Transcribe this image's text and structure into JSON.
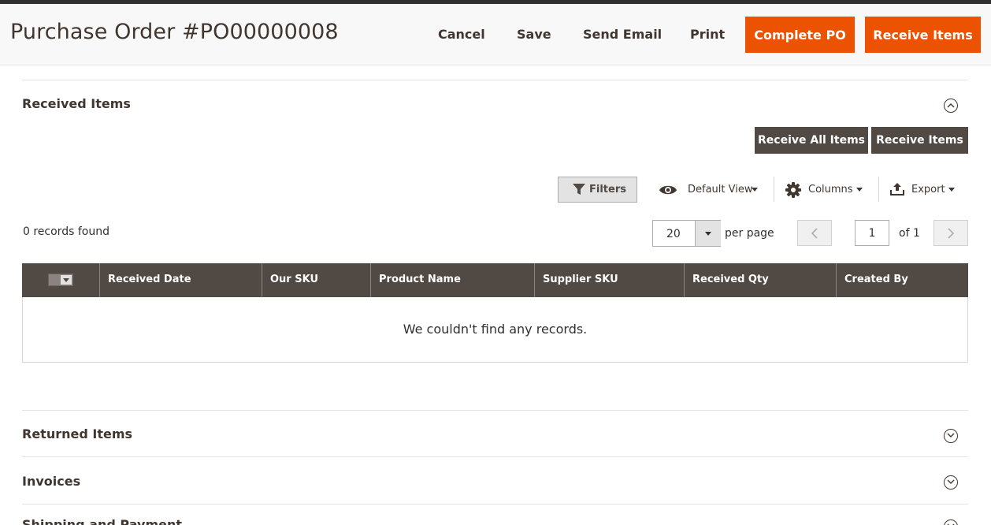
{
  "page": {
    "title": "Purchase Order #PO00000008"
  },
  "header_actions": {
    "cancel": "Cancel",
    "save": "Save",
    "send_email": "Send Email",
    "print": "Print",
    "complete_po": "Complete PO",
    "receive_items": "Receive Items"
  },
  "sections": {
    "received": {
      "title": "Received Items",
      "state": "expanded"
    },
    "returned": {
      "title": "Returned Items",
      "state": "collapsed"
    },
    "invoices": {
      "title": "Invoices",
      "state": "collapsed"
    },
    "shipping": {
      "title": "Shipping and Payment",
      "state": "collapsed"
    }
  },
  "received_actions": {
    "receive_all": "Receive All Items",
    "receive_items": "Receive Items"
  },
  "toolbar": {
    "filters": "Filters",
    "view": "Default View",
    "columns": "Columns",
    "export": "Export"
  },
  "grid": {
    "records_found": "0 records found",
    "per_page_value": "20",
    "per_page_label": "per page",
    "current_page": "1",
    "of_pages": "of 1",
    "columns": [
      "Received Date",
      "Our SKU",
      "Product Name",
      "Supplier SKU",
      "Received Qty",
      "Created By"
    ],
    "empty_message": "We couldn't find any records."
  },
  "colors": {
    "primary_button": "#eb5202",
    "secondary_button": "#514943",
    "grid_header": "#514943",
    "text_dark": "#41362f"
  },
  "icons": [
    "filter-icon",
    "eye-icon",
    "gear-icon",
    "upload-icon",
    "chevron-up-icon",
    "chevron-down-icon",
    "chevron-left-icon",
    "chevron-right-icon"
  ]
}
